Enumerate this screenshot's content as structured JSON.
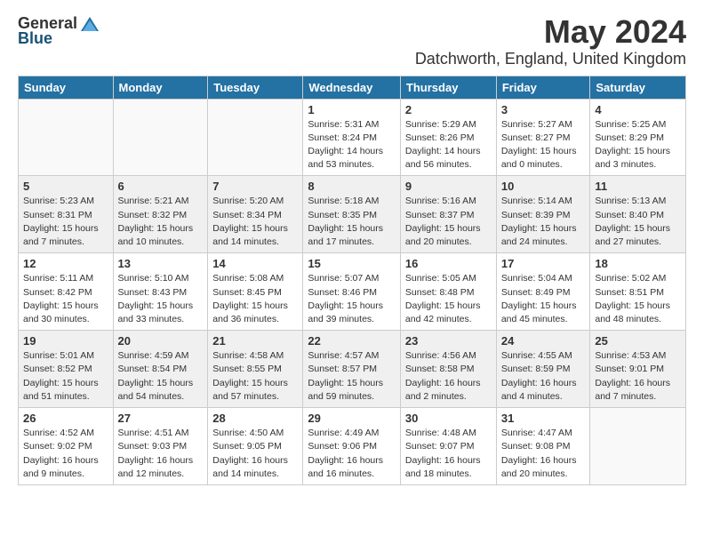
{
  "logo": {
    "general": "General",
    "blue": "Blue"
  },
  "title": "May 2024",
  "location": "Datchworth, England, United Kingdom",
  "days_of_week": [
    "Sunday",
    "Monday",
    "Tuesday",
    "Wednesday",
    "Thursday",
    "Friday",
    "Saturday"
  ],
  "weeks": [
    [
      {
        "day": "",
        "info": ""
      },
      {
        "day": "",
        "info": ""
      },
      {
        "day": "",
        "info": ""
      },
      {
        "day": "1",
        "info": "Sunrise: 5:31 AM\nSunset: 8:24 PM\nDaylight: 14 hours\nand 53 minutes."
      },
      {
        "day": "2",
        "info": "Sunrise: 5:29 AM\nSunset: 8:26 PM\nDaylight: 14 hours\nand 56 minutes."
      },
      {
        "day": "3",
        "info": "Sunrise: 5:27 AM\nSunset: 8:27 PM\nDaylight: 15 hours\nand 0 minutes."
      },
      {
        "day": "4",
        "info": "Sunrise: 5:25 AM\nSunset: 8:29 PM\nDaylight: 15 hours\nand 3 minutes."
      }
    ],
    [
      {
        "day": "5",
        "info": "Sunrise: 5:23 AM\nSunset: 8:31 PM\nDaylight: 15 hours\nand 7 minutes."
      },
      {
        "day": "6",
        "info": "Sunrise: 5:21 AM\nSunset: 8:32 PM\nDaylight: 15 hours\nand 10 minutes."
      },
      {
        "day": "7",
        "info": "Sunrise: 5:20 AM\nSunset: 8:34 PM\nDaylight: 15 hours\nand 14 minutes."
      },
      {
        "day": "8",
        "info": "Sunrise: 5:18 AM\nSunset: 8:35 PM\nDaylight: 15 hours\nand 17 minutes."
      },
      {
        "day": "9",
        "info": "Sunrise: 5:16 AM\nSunset: 8:37 PM\nDaylight: 15 hours\nand 20 minutes."
      },
      {
        "day": "10",
        "info": "Sunrise: 5:14 AM\nSunset: 8:39 PM\nDaylight: 15 hours\nand 24 minutes."
      },
      {
        "day": "11",
        "info": "Sunrise: 5:13 AM\nSunset: 8:40 PM\nDaylight: 15 hours\nand 27 minutes."
      }
    ],
    [
      {
        "day": "12",
        "info": "Sunrise: 5:11 AM\nSunset: 8:42 PM\nDaylight: 15 hours\nand 30 minutes."
      },
      {
        "day": "13",
        "info": "Sunrise: 5:10 AM\nSunset: 8:43 PM\nDaylight: 15 hours\nand 33 minutes."
      },
      {
        "day": "14",
        "info": "Sunrise: 5:08 AM\nSunset: 8:45 PM\nDaylight: 15 hours\nand 36 minutes."
      },
      {
        "day": "15",
        "info": "Sunrise: 5:07 AM\nSunset: 8:46 PM\nDaylight: 15 hours\nand 39 minutes."
      },
      {
        "day": "16",
        "info": "Sunrise: 5:05 AM\nSunset: 8:48 PM\nDaylight: 15 hours\nand 42 minutes."
      },
      {
        "day": "17",
        "info": "Sunrise: 5:04 AM\nSunset: 8:49 PM\nDaylight: 15 hours\nand 45 minutes."
      },
      {
        "day": "18",
        "info": "Sunrise: 5:02 AM\nSunset: 8:51 PM\nDaylight: 15 hours\nand 48 minutes."
      }
    ],
    [
      {
        "day": "19",
        "info": "Sunrise: 5:01 AM\nSunset: 8:52 PM\nDaylight: 15 hours\nand 51 minutes."
      },
      {
        "day": "20",
        "info": "Sunrise: 4:59 AM\nSunset: 8:54 PM\nDaylight: 15 hours\nand 54 minutes."
      },
      {
        "day": "21",
        "info": "Sunrise: 4:58 AM\nSunset: 8:55 PM\nDaylight: 15 hours\nand 57 minutes."
      },
      {
        "day": "22",
        "info": "Sunrise: 4:57 AM\nSunset: 8:57 PM\nDaylight: 15 hours\nand 59 minutes."
      },
      {
        "day": "23",
        "info": "Sunrise: 4:56 AM\nSunset: 8:58 PM\nDaylight: 16 hours\nand 2 minutes."
      },
      {
        "day": "24",
        "info": "Sunrise: 4:55 AM\nSunset: 8:59 PM\nDaylight: 16 hours\nand 4 minutes."
      },
      {
        "day": "25",
        "info": "Sunrise: 4:53 AM\nSunset: 9:01 PM\nDaylight: 16 hours\nand 7 minutes."
      }
    ],
    [
      {
        "day": "26",
        "info": "Sunrise: 4:52 AM\nSunset: 9:02 PM\nDaylight: 16 hours\nand 9 minutes."
      },
      {
        "day": "27",
        "info": "Sunrise: 4:51 AM\nSunset: 9:03 PM\nDaylight: 16 hours\nand 12 minutes."
      },
      {
        "day": "28",
        "info": "Sunrise: 4:50 AM\nSunset: 9:05 PM\nDaylight: 16 hours\nand 14 minutes."
      },
      {
        "day": "29",
        "info": "Sunrise: 4:49 AM\nSunset: 9:06 PM\nDaylight: 16 hours\nand 16 minutes."
      },
      {
        "day": "30",
        "info": "Sunrise: 4:48 AM\nSunset: 9:07 PM\nDaylight: 16 hours\nand 18 minutes."
      },
      {
        "day": "31",
        "info": "Sunrise: 4:47 AM\nSunset: 9:08 PM\nDaylight: 16 hours\nand 20 minutes."
      },
      {
        "day": "",
        "info": ""
      }
    ]
  ]
}
